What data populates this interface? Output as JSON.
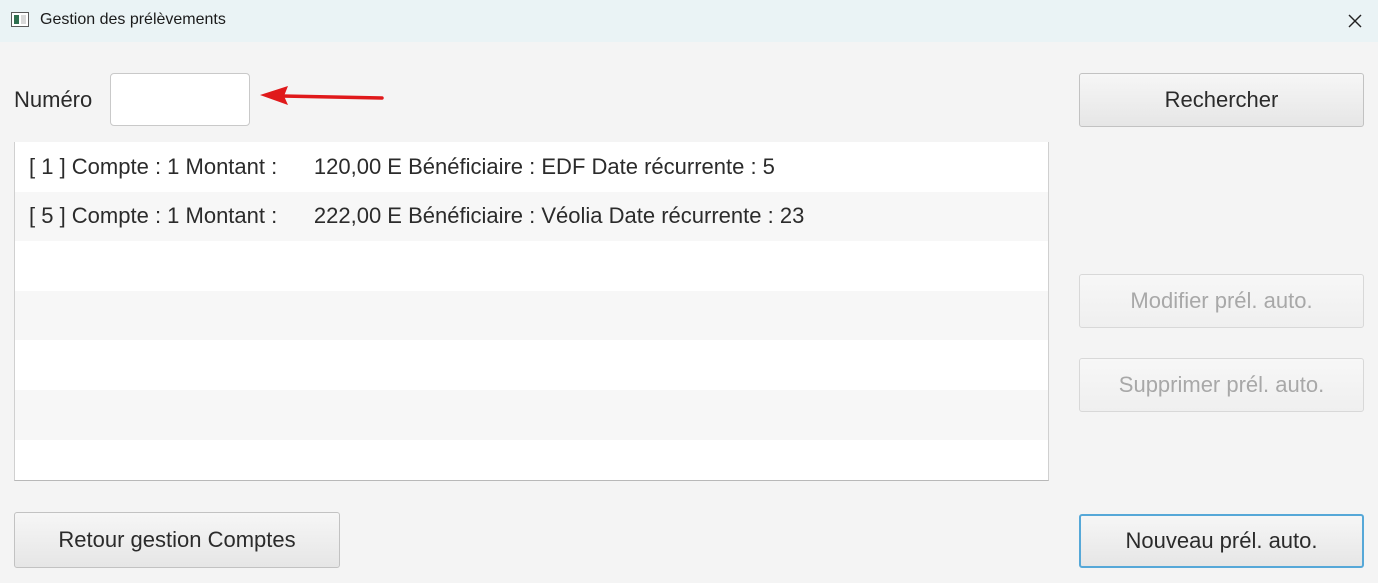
{
  "window": {
    "title": "Gestion des prélèvements"
  },
  "form": {
    "numero_label": "Numéro",
    "numero_value": "",
    "numero_placeholder": ""
  },
  "prelevements": [
    {
      "text": "[ 1 ] Compte : 1 Montant :      120,00 E Bénéficiaire : EDF Date récurrente : 5"
    },
    {
      "text": "[ 5 ] Compte : 1 Montant :      222,00 E Bénéficiaire : Véolia Date récurrente : 23"
    },
    {
      "text": ""
    },
    {
      "text": ""
    },
    {
      "text": ""
    },
    {
      "text": ""
    },
    {
      "text": ""
    }
  ],
  "buttons": {
    "rechercher": "Rechercher",
    "modifier": "Modifier prél. auto.",
    "supprimer": "Supprimer prél. auto.",
    "nouveau": "Nouveau prél. auto.",
    "retour": "Retour gestion Comptes"
  },
  "colors": {
    "annotation_arrow": "#e0191b",
    "focus_border": "#56a8d8",
    "disabled_text": "#a8a8a8"
  },
  "icons": {
    "app": "window-app-icon",
    "close": "close-icon",
    "annotation": "red-arrow-annotation"
  }
}
